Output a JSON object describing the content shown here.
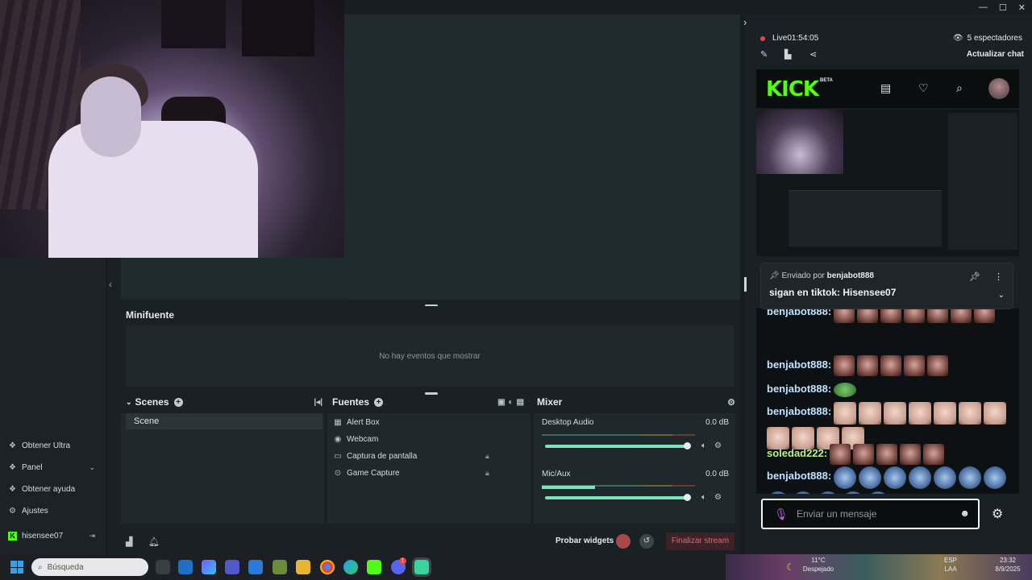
{
  "window": {
    "controls": [
      "—",
      "☐",
      "✕"
    ]
  },
  "minifuente": {
    "title": "Minifuente",
    "empty_text": "No hay eventos que mostrar"
  },
  "scenes": {
    "title": "Scenes",
    "items": [
      "Scene"
    ]
  },
  "sources": {
    "title": "Fuentes",
    "items": [
      "Alert Box",
      "Webcam",
      "Captura de pantalla",
      "Game Capture"
    ]
  },
  "mixer": {
    "title": "Mixer",
    "channels": [
      {
        "name": "Desktop Audio",
        "db": "0.0 dB",
        "level": 0.0
      },
      {
        "name": "Mic/Aux",
        "db": "0.0 dB",
        "level": 0.35
      }
    ]
  },
  "bottom": {
    "probar": "Probar widgets",
    "end": "Finalizar stream"
  },
  "sidebar": {
    "items": [
      {
        "label": "Obtener Ultra",
        "icon": "sparkle-icon"
      },
      {
        "label": "Panel",
        "icon": "dashboard-icon"
      },
      {
        "label": "Obtener ayuda",
        "icon": "help-icon"
      },
      {
        "label": "Ajustes",
        "icon": "gear-icon"
      }
    ],
    "account": "hisensee07"
  },
  "stream": {
    "live_label": "Live",
    "duration": "01:54:05",
    "viewers": "5 espectadores",
    "refresh_chat": "Actualizar chat"
  },
  "kick": {
    "logo": "KICK",
    "beta": "BETA",
    "brand_color": "#53fc18"
  },
  "pinned": {
    "by_label": "Enviado por",
    "by_user": "benjabot888",
    "message": "sigan en tiktok: Hisensee07"
  },
  "chat": {
    "messages": [
      {
        "user": "benjabot888:"
      },
      {
        "user": "benjabot888:"
      },
      {
        "user": "benjabot888:"
      },
      {
        "user": "benjabot888:"
      },
      {
        "user": "soledad222:"
      },
      {
        "user": "benjabot888:"
      }
    ],
    "placeholder": "Enviar un mensaje"
  },
  "taskbar": {
    "search": "Búsqueda",
    "weather_temp": "11°C",
    "weather_desc": "Despejado",
    "lang": "ESP",
    "lang2": "LAA",
    "time": "23:32",
    "date": "8/9/2025",
    "badge": "1"
  }
}
